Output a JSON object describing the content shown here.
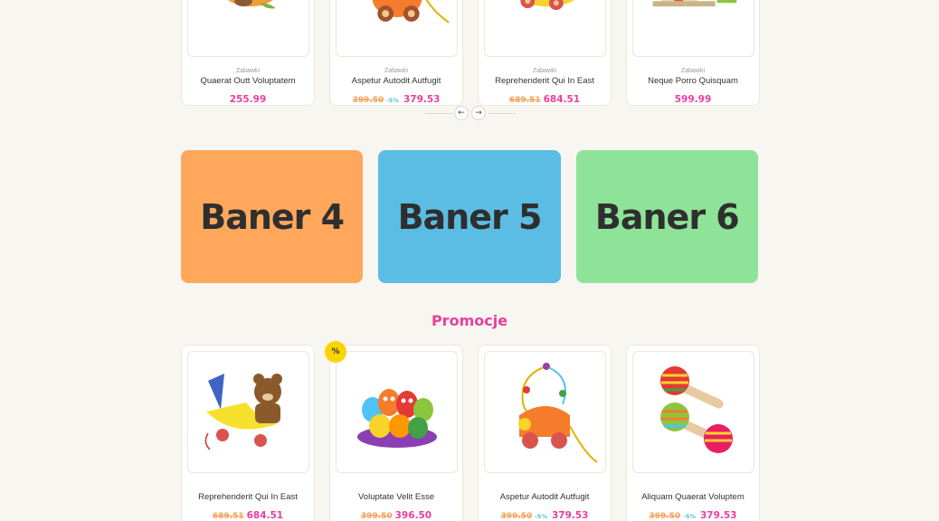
{
  "colors": {
    "accent": "#ea3ea0",
    "old_price": "#f3a25a",
    "discount": "#52b9e1",
    "badge": "#ffd400"
  },
  "carousel": {
    "products": [
      {
        "category": "Zabawki",
        "name": "Quaerat Outt Voluptatem",
        "old_price": "",
        "discount": "",
        "price": "255.99"
      },
      {
        "category": "Zabawki",
        "name": "Aspetur Autodit Autfugit",
        "old_price": "399.50",
        "discount": "-5%",
        "price": "379.53"
      },
      {
        "category": "Zabawki",
        "name": "Reprehenderit Qui In East",
        "old_price": "689.51",
        "discount": "",
        "price": "684.51"
      },
      {
        "category": "Zabawki",
        "name": "Neque Porro Quisquam",
        "old_price": "",
        "discount": "",
        "price": "599.99"
      }
    ],
    "prev_icon": "arrow-left-icon",
    "next_icon": "arrow-right-icon",
    "prev_glyph": "←",
    "next_glyph": "→"
  },
  "banners": [
    {
      "label": "Baner 4",
      "color": "#ffa85c"
    },
    {
      "label": "Baner 5",
      "color": "#5bbde3"
    },
    {
      "label": "Baner 6",
      "color": "#8ee398"
    }
  ],
  "promo": {
    "title": "Promocje",
    "badge": "%",
    "products": [
      {
        "name": "Reprehenderit Qui In East",
        "old_price": "689.51",
        "discount": "",
        "price": "684.51"
      },
      {
        "name": "Voluptate Velit Esse",
        "old_price": "399.50",
        "discount": "",
        "price": "396.50"
      },
      {
        "name": "Aspetur Autodit Autfugit",
        "old_price": "399.50",
        "discount": "-5%",
        "price": "379.53"
      },
      {
        "name": "Aliquam Quaerat Voluptem",
        "old_price": "399.50",
        "discount": "-5%",
        "price": "379.53"
      }
    ]
  }
}
